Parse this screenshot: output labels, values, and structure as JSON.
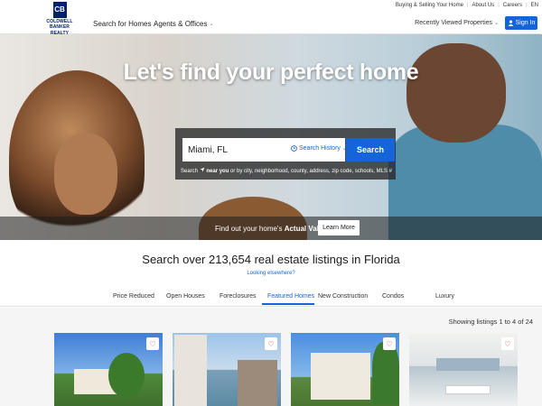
{
  "header": {
    "logo_line1": "COLDWELL BANKER",
    "logo_line2": "REALTY",
    "logo_mark": "CB",
    "nav": [
      {
        "label": "Search for Homes"
      },
      {
        "label": "Agents & Offices"
      }
    ],
    "utility": [
      "Buying & Selling Your Home",
      "About Us",
      "Careers",
      "EN"
    ],
    "recently_viewed": "Recently Viewed Properties",
    "sign_in": "Sign In"
  },
  "hero": {
    "title": "Let's find your perfect home",
    "search_value": "Miami, FL",
    "search_history": "Search History",
    "search_button": "Search",
    "hint_prefix": "Search",
    "hint_bold": "near you",
    "hint_suffix": "or by city, neighborhood, county, address, zip code, schools, MLS #",
    "value_prefix": "Find out your home's",
    "value_bold": "Actual Value",
    "learn_more": "Learn More"
  },
  "listings": {
    "heading": "Search over 213,654 real estate listings in Florida",
    "elsewhere": "Looking elsewhere?",
    "tabs": [
      "Price Reduced",
      "Open Houses",
      "Foreclosures",
      "Featured Homes",
      "New Construction",
      "Condos",
      "Luxury"
    ],
    "active_tab": "Featured Homes",
    "count_text": "Showing listings 1 to 4 of 24"
  },
  "colors": {
    "brand_blue": "#1565d8",
    "brand_navy": "#012169"
  },
  "icons": [
    "chevron-down-icon",
    "user-icon",
    "clock-icon",
    "location-arrow-icon",
    "heart-icon"
  ]
}
